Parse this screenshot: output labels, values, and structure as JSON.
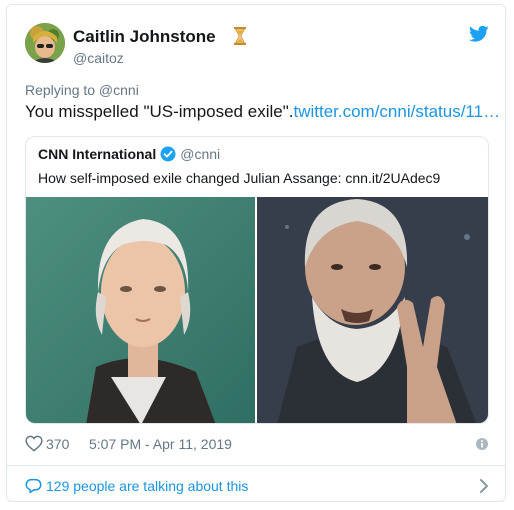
{
  "author": {
    "name": "Caitlin Johnstone",
    "handle": "@caitoz",
    "badge_icon": "hourglass-icon",
    "avatar_icon": "avatar-icon"
  },
  "tweet": {
    "replying_to": "Replying to @cnni",
    "text": "You misspelled \"US-imposed exile\".",
    "link": "twitter.com/cnni/status/11…"
  },
  "quoted": {
    "name": "CNN International",
    "handle": "@cnni",
    "text": "How self-imposed exile changed Julian Assange: cnn.it/2UAdec9",
    "verified_icon": "verified-badge-icon"
  },
  "footer": {
    "likes": "370",
    "timestamp": "5:07 PM - Apr 11, 2019",
    "talking": "129 people are talking about this"
  },
  "colors": {
    "accent": "#1b95e0",
    "text": "#14171a",
    "muted": "#657786",
    "border": "#e1e8ed"
  }
}
